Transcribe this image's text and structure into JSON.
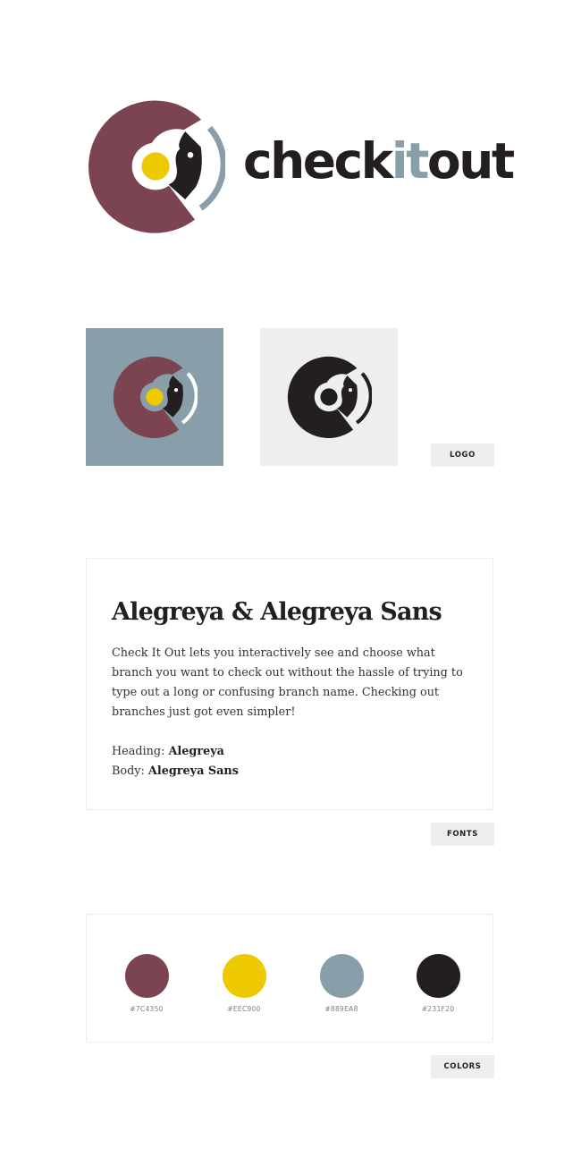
{
  "brand": {
    "wordmark_pre": "check",
    "wordmark_accent": "it",
    "wordmark_post": "out"
  },
  "sections": {
    "logo_label": "LOGO",
    "fonts_label": "FONTS",
    "colors_label": "COLORS"
  },
  "fonts": {
    "heading": "Alegreya & Alegreya Sans",
    "body": "Check It Out lets you interactively see and choose what branch you want to check out without the hassle of trying to type out a long or confusing branch name. Checking out branches just got even simpler!",
    "heading_label": "Heading:",
    "heading_font": "Alegreya",
    "body_label": "Body:",
    "body_font": "Alegreya Sans"
  },
  "colors": [
    {
      "hex": "#7C4350",
      "label": "#7C4350"
    },
    {
      "hex": "#EEC900",
      "label": "#EEC900"
    },
    {
      "hex": "#889EA8",
      "label": "#889EA8"
    },
    {
      "hex": "#231F20",
      "label": "#231F20"
    }
  ]
}
